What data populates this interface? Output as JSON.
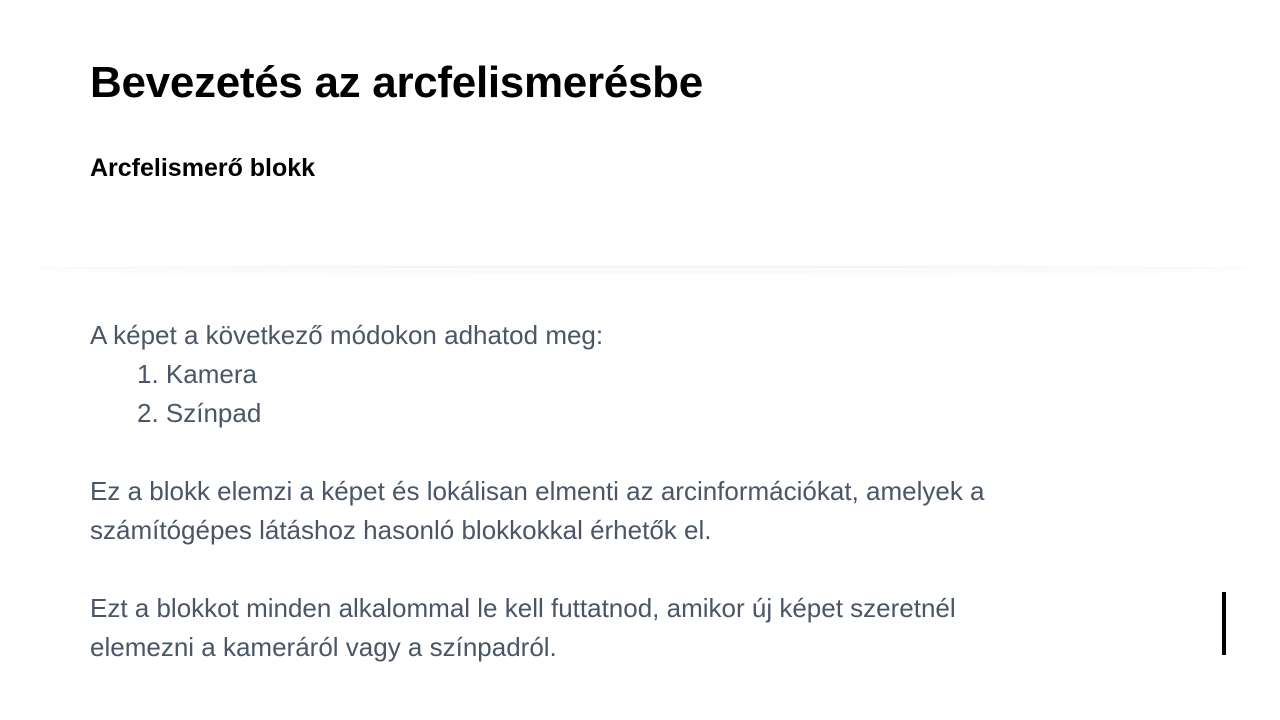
{
  "slide": {
    "title": "Bevezetés az arcfelismerésbe",
    "subtitle": "Arcfelismerő blokk",
    "intro": "A képet a következő módokon adhatod meg:",
    "list_items": [
      "1. Kamera",
      "2. Színpad"
    ],
    "paragraph_1_line_1": "Ez a blokk elemzi a képet és lokálisan elmenti az arcinformációkat, amelyek a",
    "paragraph_1_line_2": "számítógépes látáshoz hasonló blokkokkal érhetők el.",
    "paragraph_2_line_1": "Ezt a blokkot minden alkalommal le kell futtatnod, amikor új képet szeretnél",
    "paragraph_2_line_2": "elemezni a kameráról vagy a színpadról."
  },
  "colors": {
    "title": "#000000",
    "body_text": "#4a5668",
    "background": "#ffffff"
  }
}
